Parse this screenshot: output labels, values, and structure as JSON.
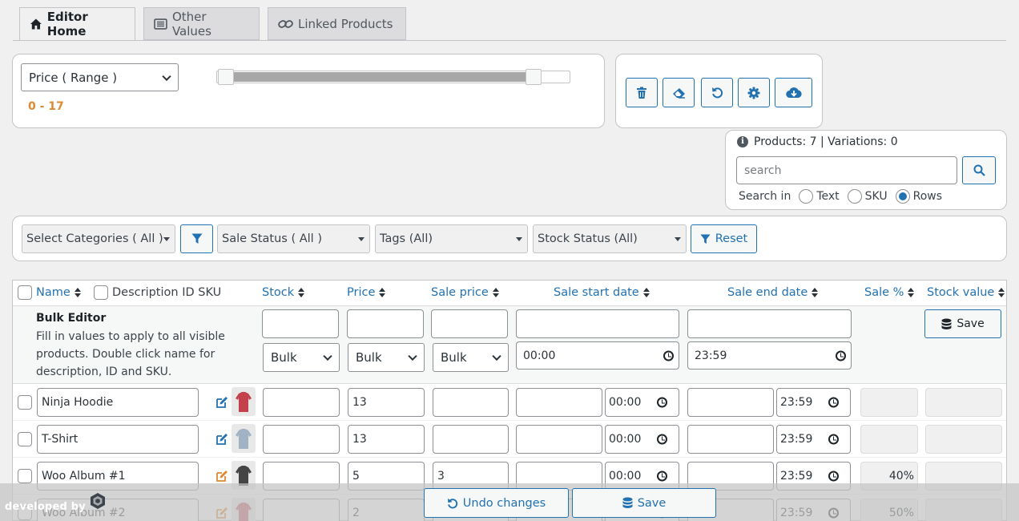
{
  "tabs": [
    {
      "label": "Editor Home",
      "icon": "home-icon"
    },
    {
      "label": "Other Values",
      "icon": "list-icon"
    },
    {
      "label": "Linked Products",
      "icon": "link-icon"
    }
  ],
  "filter": {
    "select_label": "Price ( Range )",
    "range_text": "0 - 17",
    "range_min": 0,
    "range_max": 17,
    "slider_low": 0.0,
    "slider_high": 1.0,
    "accent": "#dd8833"
  },
  "toolbar": {
    "icons": [
      "trash-icon",
      "eraser-icon",
      "undo-icon",
      "gear-icon",
      "cloud-download-icon"
    ]
  },
  "search": {
    "counts": "Products: 7 | Variations: 0",
    "placeholder": "search",
    "search_in_label": "Search in",
    "options": [
      "Text",
      "SKU",
      "Rows"
    ],
    "selected": "Rows"
  },
  "filters": {
    "categories": "Select Categories ( All )",
    "sale_status": "Sale Status ( All )",
    "tags": "Tags (All)",
    "stock_status": "Stock Status (All)",
    "reset_label": "Reset"
  },
  "table": {
    "headers": {
      "name": "Name",
      "desc": "Description ID SKU",
      "stock": "Stock",
      "price": "Price",
      "sale_price": "Sale price",
      "sale_start": "Sale start date",
      "sale_end": "Sale end date",
      "sale_pct": "Sale %",
      "stock_value": "Stock value"
    },
    "bulk": {
      "title": "Bulk Editor",
      "help_1": "Fill in values to apply to all visible",
      "help_2": "products. Double click name for",
      "help_3": "description, ID and SKU.",
      "bulk_label": "Bulk",
      "start_time": "00:00",
      "end_time": "23:59",
      "save_label": "Save"
    },
    "rows": [
      {
        "name": "Ninja Hoodie",
        "stock": "",
        "price": "13",
        "sale_price": "",
        "start_time": "00:00",
        "end_time": "23:59",
        "sale_pct": "",
        "stock_value": ""
      },
      {
        "name": "T-Shirt",
        "stock": "",
        "price": "13",
        "sale_price": "",
        "start_time": "00:00",
        "end_time": "23:59",
        "sale_pct": "",
        "stock_value": ""
      },
      {
        "name": "Woo Album #1",
        "stock": "",
        "price": "5",
        "sale_price": "3",
        "start_time": "00:00",
        "end_time": "23:59",
        "sale_pct": "40%",
        "stock_value": ""
      },
      {
        "name": "Woo Album #2",
        "stock": "",
        "price": "2",
        "sale_price": "",
        "start_time": "",
        "end_time": "23:59",
        "sale_pct": "50%",
        "stock_value": ""
      }
    ]
  },
  "footer": {
    "developed_by": "developed by",
    "undo_label": "Undo changes",
    "save_label": "Save"
  },
  "colors": {
    "accent_blue": "#2271b1",
    "orange": "#dd8833",
    "panel_bg": "#ffffff",
    "page_bg": "#f0f0f1"
  }
}
